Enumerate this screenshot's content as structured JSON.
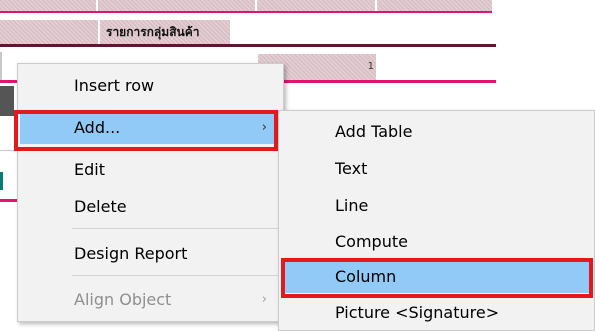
{
  "report": {
    "group_header": "รายการกลุ่มสินค้า",
    "cell_value": "1"
  },
  "context_menu": {
    "items": [
      {
        "label": "Insert row",
        "enabled": true,
        "submenu": false
      },
      {
        "label": "Add...",
        "enabled": true,
        "submenu": true,
        "highlighted": true
      },
      {
        "label": "Edit",
        "enabled": true,
        "submenu": false
      },
      {
        "label": "Delete",
        "enabled": true,
        "submenu": false
      },
      {
        "label": "Design Report",
        "enabled": true,
        "submenu": false
      },
      {
        "label": "Align Object",
        "enabled": false,
        "submenu": true
      }
    ],
    "arrow_glyph": "›"
  },
  "add_submenu": {
    "items": [
      {
        "label": "Add Table"
      },
      {
        "label": "Text"
      },
      {
        "label": "Line"
      },
      {
        "label": "Compute"
      },
      {
        "label": "Column",
        "highlighted": true
      },
      {
        "label": "Picture <Signature>"
      }
    ]
  },
  "colors": {
    "menu_highlight": "#91c9f7",
    "annotation_red": "#e4191d",
    "band_pink": "#e4146e",
    "band_hatch": "#d9c0c6"
  },
  "icons": [
    "submenu-arrow-icon"
  ]
}
